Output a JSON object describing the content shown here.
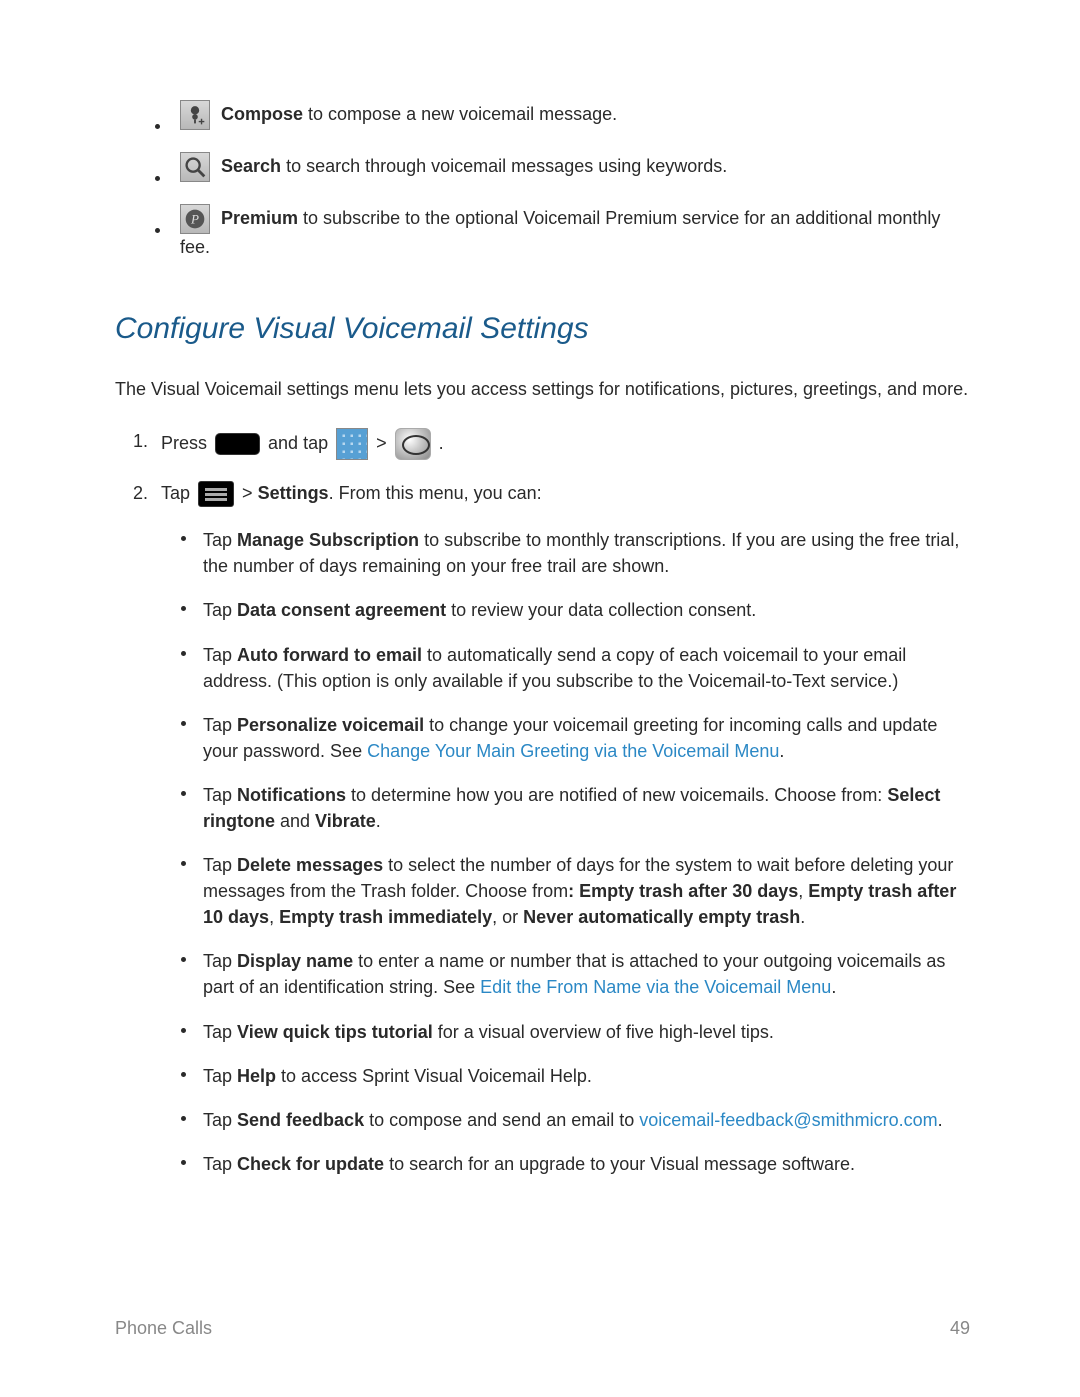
{
  "top_items": [
    {
      "icon": "mic",
      "bold": "Compose",
      "text": " to compose a new voicemail message."
    },
    {
      "icon": "search",
      "bold": "Search",
      "text": " to search through voicemail messages using keywords."
    },
    {
      "icon": "premium",
      "bold": "Premium",
      "text": " to subscribe to the optional Voicemail Premium service for an additional monthly fee."
    }
  ],
  "heading": "Configure Visual Voicemail Settings",
  "intro": "The Visual Voicemail settings menu lets you access settings for notifications, pictures, greetings, and more.",
  "step1": {
    "press": "Press ",
    "andtap": " and tap ",
    "sep": " > ",
    "end": "."
  },
  "step2": {
    "tap": "Tap ",
    "sep": " > ",
    "settings": "Settings",
    "after": ". From this menu, you can:"
  },
  "sub": [
    {
      "tap": "Tap ",
      "bold": "Manage Subscription",
      "text": " to subscribe to monthly transcriptions. If you are using the free trial, the number of days remaining on your free trail are shown."
    },
    {
      "tap": "Tap ",
      "bold": "Data consent agreement",
      "text": " to review your data collection consent."
    },
    {
      "tap": "Tap ",
      "bold": "Auto forward to email",
      "text": " to automatically send a copy of each voicemail to your email address. (This option is only available if you subscribe to the Voicemail-to-Text service.)"
    },
    {
      "tap": "Tap ",
      "bold": "Personalize voicemail",
      "text": " to change your voicemail greeting for incoming calls and update your password. See ",
      "link": "Change Your Main Greeting via the Voicemail Menu",
      "after": "."
    },
    {
      "tap": "Tap ",
      "bold": "Notifications",
      "text": " to determine how you are notified of new voicemails. Choose from: ",
      "bold2": "Select ringtone",
      "mid": " and ",
      "bold3": "Vibrate",
      "after": "."
    },
    {
      "tap": "Tap ",
      "bold": "Delete messages",
      "textA": " to select the number of days for the system to wait before deleting your messages from the Trash folder. Choose from",
      "boldA": ": Empty trash after 30 days",
      "sepA": ", ",
      "boldB": "Empty trash after 10 days",
      "sepB": ", ",
      "boldC": "Empty trash immediately",
      "sepC": ", or ",
      "boldD": "Never automatically empty trash",
      "after": "."
    },
    {
      "tap": "Tap ",
      "bold": "Display name",
      "text": " to enter a name or number that is attached to your outgoing voicemails as part of an identification string. See ",
      "link": "Edit the From Name via the Voicemail Menu",
      "after": "."
    },
    {
      "tap": "Tap ",
      "bold": "View quick tips tutorial",
      "text": " for a visual overview of five high-level tips."
    },
    {
      "tap": "Tap ",
      "bold": "Help",
      "text": " to access Sprint Visual Voicemail Help."
    },
    {
      "tap": "Tap ",
      "bold": "Send feedback",
      "text": " to compose and send an email to ",
      "link": "voicemail-feedback@smithmicro.com",
      "after": "."
    },
    {
      "tap": "Tap ",
      "bold": "Check for update",
      "text": " to search for an upgrade to your Visual message software."
    }
  ],
  "footer": {
    "section": "Phone Calls",
    "page": "49"
  }
}
